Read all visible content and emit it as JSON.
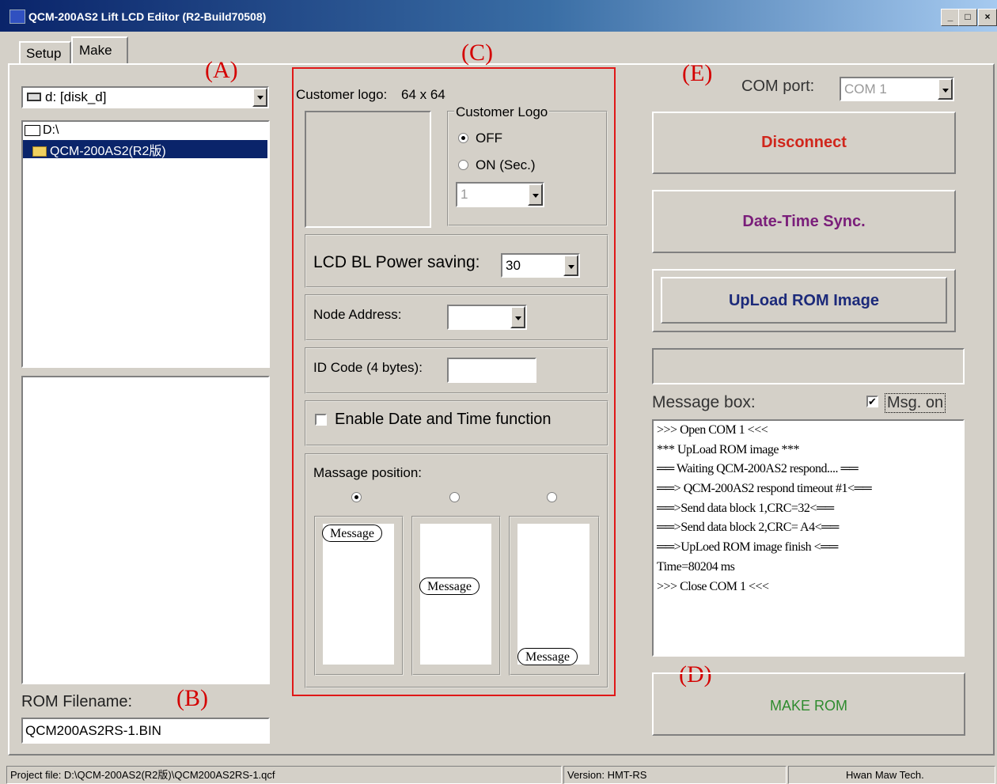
{
  "window": {
    "title": "QCM-200AS2 Lift LCD Editor (R2-Build70508)",
    "min_label": "_",
    "max_label": "□",
    "close_label": "×"
  },
  "tabs": [
    {
      "label": "Setup",
      "active": false
    },
    {
      "label": "Make",
      "active": true
    }
  ],
  "annotations": {
    "a": "(A)",
    "b": "(B)",
    "c": "(C)",
    "d": "(D)",
    "e": "(E)"
  },
  "left_panel": {
    "drive_select": "d: [disk_d]",
    "tree": [
      {
        "label": "D:\\",
        "selected": false
      },
      {
        "label": "QCM-200AS2(R2版)",
        "selected": true
      }
    ],
    "rom_filename_label": "ROM Filename:",
    "rom_filename_value": "QCM200AS2RS-1.BIN"
  },
  "center_panel": {
    "customer_logo_label": "Customer logo:",
    "customer_logo_size": "64 x 64",
    "logo_group_title": "Customer Logo",
    "logo_off_label": "OFF",
    "logo_on_label": "ON (Sec.)",
    "logo_seconds": "1",
    "lcd_bl_label": "LCD BL Power saving:",
    "lcd_bl_value": "30",
    "node_address_label": "Node Address:",
    "node_address_value": "",
    "id_code_label": "ID Code (4 bytes):",
    "id_code_value": "",
    "date_time_label": "Enable Date and Time function",
    "date_time_checked": false,
    "message_position_label": "Massage position:",
    "message_previews": [
      "Message",
      "Message",
      "Message"
    ],
    "selected_position": 0
  },
  "right_panel": {
    "com_port_label": "COM port:",
    "com_port_value": "COM 1",
    "disconnect_label": "Disconnect",
    "date_time_sync_label": "Date-Time Sync.",
    "upload_label": "UpLoad ROM Image",
    "message_box_label": "Message box:",
    "msg_on_label": "Msg. on",
    "msg_on_checked": true,
    "messages": [
      ">>> Open COM 1 <<<",
      "*** UpLoad ROM image ***",
      "══ Waiting QCM-200AS2 respond.... ══",
      "══> QCM-200AS2 respond timeout #1<══",
      "══>Send data block 1,CRC=32<══",
      "══>Send data block 2,CRC= A4<══",
      "══>UpLoed ROM image finish <══",
      "Time=80204 ms",
      ">>> Close COM 1 <<<"
    ],
    "make_rom_label": "MAKE ROM"
  },
  "status_bar": {
    "project_file": "Project file: D:\\QCM-200AS2(R2版)\\QCM200AS2RS-1.qcf",
    "version": "Version: HMT-RS",
    "company": "Hwan Maw Tech."
  },
  "colors": {
    "disconnect": "#d0261c",
    "date_time_sync": "#7a1e7a",
    "upload": "#1c2a7a",
    "make_rom": "#2e8b2e",
    "annotation": "#d40000",
    "selection": "#0a246a"
  }
}
